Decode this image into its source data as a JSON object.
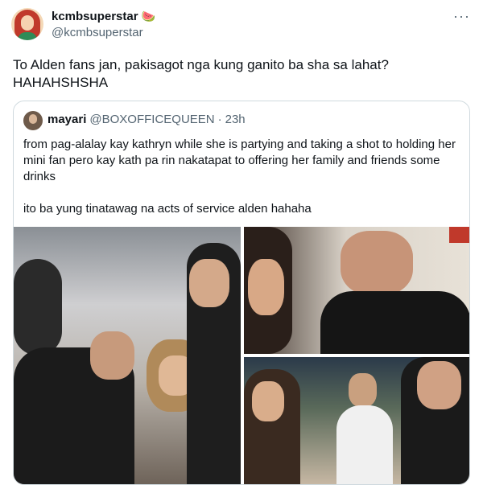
{
  "author": {
    "display_name": "kcmbsuperstar",
    "emoji": "🍉",
    "handle": "@kcmbsuperstar"
  },
  "menu_glyph": "···",
  "tweet_text": "To Alden fans jan, pakisagot nga kung ganito ba sha sa lahat?\nHAHAHSHSHA",
  "quote": {
    "display_name": "mayari",
    "handle": "@BOXOFFICEQUEEN",
    "separator": "·",
    "time": "23h",
    "text": "from pag-alalay kay kathryn while she is partying and taking a shot to holding her mini fan pero kay kath pa rin nakatapat to offering her family and friends some drinks\n\nito ba yung tinatawag na acts of service alden hahaha"
  }
}
